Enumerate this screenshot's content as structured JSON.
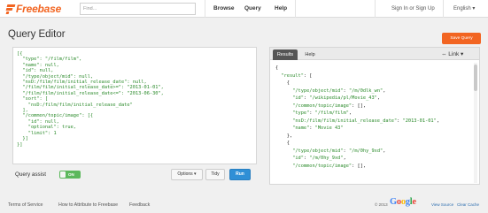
{
  "header": {
    "logo_text": "Freebase",
    "search_placeholder": "Find...",
    "nav": [
      "Browse",
      "Query",
      "Help"
    ],
    "sign_in": "Sign In or Sign Up",
    "language": "English ▾"
  },
  "editor": {
    "title": "Query Editor",
    "save_label": "Save Query",
    "query_lines": [
      "[{",
      "  \"type\": \"/film/film\",",
      "  \"name\": null,",
      "  \"id\": null,",
      "  \"/type/object/mid\": null,",
      "  \"nsD:/film/film/initial_release_date\": null,",
      "  \"/film/film/initial_release_date>=\": \"2013-01-01\",",
      "  \"/film/film/initial_release_date<=\": \"2013-06-30\",",
      "  \"sort\": [",
      "    \"nsD:/film/film/initial_release_date\"",
      "  ],",
      "  \"/common/topic/image\": [{",
      "    \"id\": null,",
      "    \"optional\": true,",
      "    \"limit\": 1",
      "  }]",
      "}]"
    ],
    "query_assist_label": "Query assist",
    "query_assist_state": "ON",
    "options_label": "Options ▾",
    "tidy_label": "Tidy",
    "run_label": "Run"
  },
  "results": {
    "tabs": [
      "Results",
      "Help"
    ],
    "link_label": "⇔ Link ▾",
    "lines": [
      "{",
      "  \"result\": [",
      "    {",
      "      \"/type/object/mid\": \"/m/0dlk_wn\",",
      "      \"id\": \"/wikipedia/pl/Movie_43\",",
      "      \"/common/topic/image\": [],",
      "      \"type\": \"/film/film\",",
      "      \"nsD:/film/film/initial_release_date\": \"2013-01-01\",",
      "      \"name\": \"Movie 43\"",
      "    },",
      "    {",
      "      \"/type/object/mid\": \"/m/0hy_9xd\",",
      "      \"id\": \"/m/0hy_9xd\",",
      "      \"/common/topic/image\": [],"
    ]
  },
  "footer": {
    "links": [
      "Terms of Service",
      "How to Attribute to Freebase",
      "Feedback"
    ],
    "copyright": "© 2013",
    "brand": "Google",
    "view_source": "View Source",
    "clear_cache": "Clear Cache"
  },
  "colors": {
    "brand_orange": "#f26522",
    "run_blue": "#2f8fd6",
    "toggle_green": "#5cb85c",
    "code_green": "#2a8a2a"
  }
}
